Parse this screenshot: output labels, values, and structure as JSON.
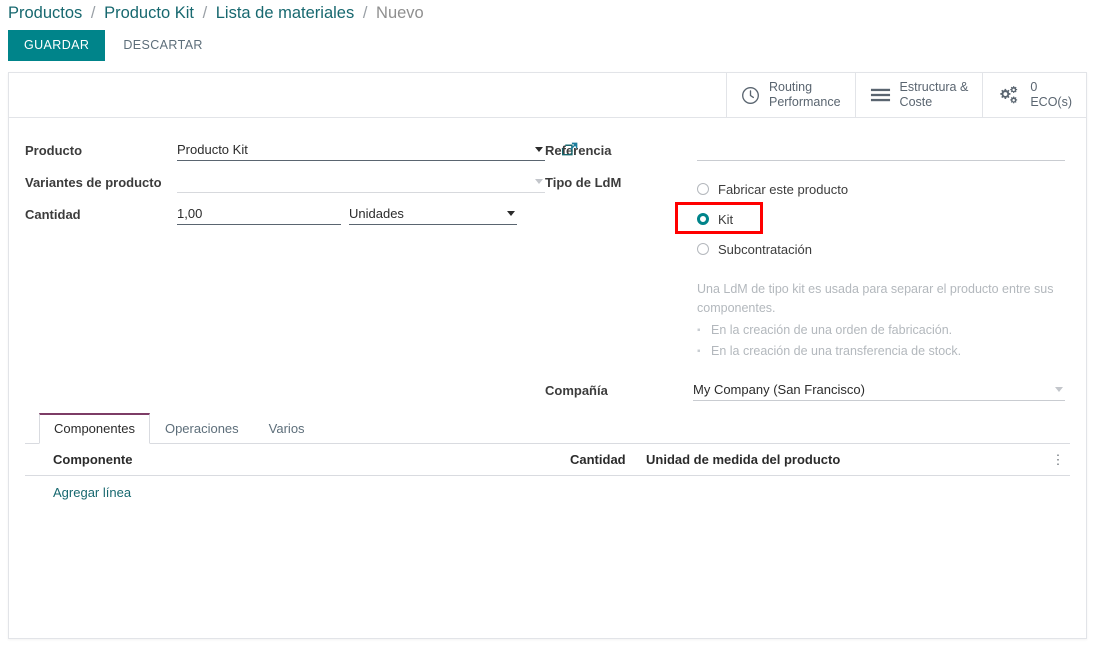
{
  "breadcrumb": {
    "items": [
      {
        "label": "Productos",
        "current": false
      },
      {
        "label": "Producto Kit",
        "current": false
      },
      {
        "label": "Lista de materiales",
        "current": false
      },
      {
        "label": "Nuevo",
        "current": true
      }
    ],
    "separator": "/"
  },
  "actions": {
    "save_label": "GUARDAR",
    "discard_label": "DESCARTAR"
  },
  "smart_buttons": [
    {
      "icon": "clock-icon",
      "line1": "Routing",
      "line2": "Performance"
    },
    {
      "icon": "list-icon",
      "line1": "Estructura &",
      "line2": "Coste"
    },
    {
      "icon": "gears-icon",
      "line1": "0",
      "line2": "ECO(s)"
    }
  ],
  "form": {
    "producto": {
      "label": "Producto",
      "value": "Producto Kit",
      "placeholder": ""
    },
    "variantes": {
      "label": "Variantes de producto",
      "value": "",
      "placeholder": ""
    },
    "cantidad": {
      "label": "Cantidad",
      "value": "1,00",
      "uom_value": "Unidades"
    },
    "referencia": {
      "label": "Referencia",
      "value": "",
      "placeholder": ""
    },
    "tipo_ldm": {
      "label": "Tipo de LdM",
      "options": [
        {
          "label": "Fabricar este producto",
          "selected": false
        },
        {
          "label": "Kit",
          "selected": true
        },
        {
          "label": "Subcontratación",
          "selected": false
        }
      ]
    },
    "help": {
      "paragraph": "Una LdM de tipo kit es usada para separar el producto entre sus componentes.",
      "bullets": [
        "En la creación de una orden de fabricación.",
        "En la creación de una transferencia de stock."
      ]
    },
    "compania": {
      "label": "Compañía",
      "value": "My Company (San Francisco)"
    }
  },
  "notebook": {
    "tabs": [
      {
        "label": "Componentes",
        "active": true
      },
      {
        "label": "Operaciones",
        "active": false
      },
      {
        "label": "Varios",
        "active": false
      }
    ],
    "table": {
      "columns": {
        "componente": "Componente",
        "cantidad": "Cantidad",
        "uom": "Unidad de medida del producto",
        "options": "⋮"
      },
      "rows": [],
      "add_line_label": "Agregar línea"
    }
  },
  "colors": {
    "accent_teal": "#00848a",
    "link_teal": "#17686f",
    "highlight_red": "#ff0000",
    "tab_active_border": "#7d3c66"
  }
}
